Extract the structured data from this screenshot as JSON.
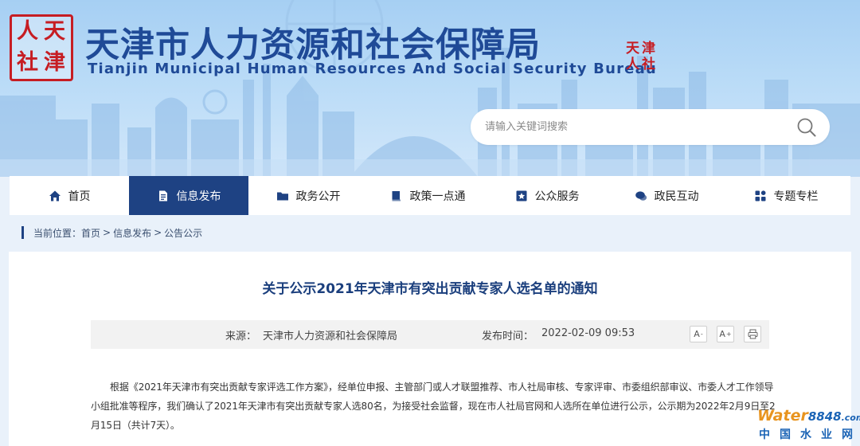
{
  "header": {
    "logo_chars": [
      "人",
      "天",
      "社",
      "津"
    ],
    "title_cn": "天津市人力资源和社会保障局",
    "title_en": "Tianjin Municipal Human Resources And Social Security Bureau",
    "seal_chars": [
      "天",
      "津",
      "人",
      "社"
    ],
    "brand_color": "#1f4a97",
    "logo_color": "#c61d23"
  },
  "search": {
    "placeholder": "请输入关键词搜索",
    "icon": "search-icon"
  },
  "nav": {
    "items": [
      {
        "label": "首页",
        "icon": "home-icon",
        "active": false
      },
      {
        "label": "信息发布",
        "icon": "document-icon",
        "active": true
      },
      {
        "label": "政务公开",
        "icon": "folder-icon",
        "active": false
      },
      {
        "label": "政策一点通",
        "icon": "book-icon",
        "active": false
      },
      {
        "label": "公众服务",
        "icon": "star-badge-icon",
        "active": false
      },
      {
        "label": "政民互动",
        "icon": "chat-icon",
        "active": false
      },
      {
        "label": "专题专栏",
        "icon": "grid-icon",
        "active": false
      }
    ],
    "active_color": "#1e4283"
  },
  "breadcrumb": {
    "prefix": "当前位置：",
    "items": [
      "首页",
      "信息发布",
      "公告公示"
    ],
    "separator": ">"
  },
  "article": {
    "title": "关于公示2021年天津市有突出贡献专家人选名单的通知",
    "source_label": "来源：",
    "source": "天津市人力资源和社会保障局",
    "time_label": "发布时间：",
    "time": "2022-02-09 09:53",
    "tools": {
      "font_decrease": "A",
      "font_decrease_mark": "-",
      "font_increase": "A",
      "font_increase_mark": "+",
      "print_icon": "print-icon"
    },
    "body": "根据《2021年天津市有突出贡献专家评选工作方案》，经单位申报、主管部门或人才联盟推荐、市人社局审核、专家评审、市委组织部审议、市委人才工作领导小组批准等程序，我们确认了2021年天津市有突出贡献专家人选80名，为接受社会监督，现在市人社局官网和人选所在单位进行公示，公示期为2022年2月9日至2月15日（共计7天）。"
  },
  "watermark": {
    "word": "Water",
    "number": "8848",
    "suffix": ".com",
    "cn": "中国水业网"
  }
}
